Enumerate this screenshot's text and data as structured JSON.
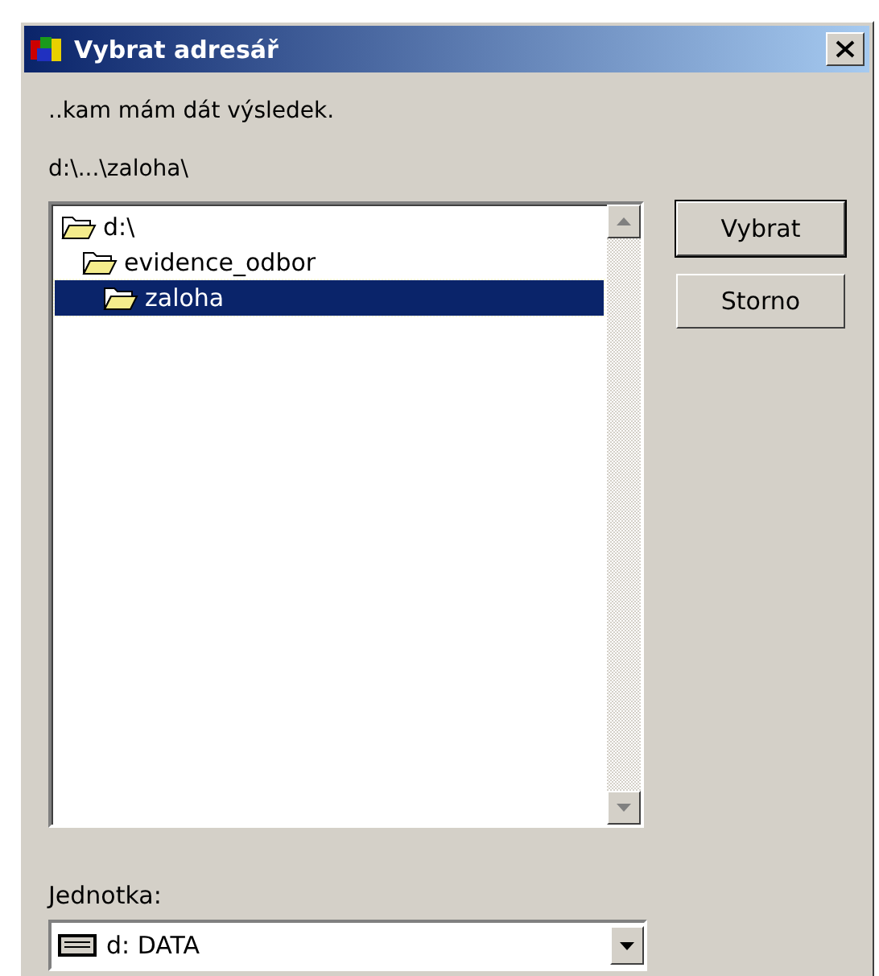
{
  "window": {
    "title": "Vybrat adresář"
  },
  "prompt": "..kam mám dát výsledek.",
  "current_path": "d:\\...\\zaloha\\",
  "folder_tree": [
    {
      "label": "d:\\",
      "selected": false,
      "children": [
        {
          "label": "evidence_odbor",
          "selected": false,
          "children": [
            {
              "label": "zaloha",
              "selected": true
            }
          ]
        }
      ]
    }
  ],
  "buttons": [
    {
      "label": "Vybrat",
      "default": true
    },
    {
      "label": "Storno",
      "default": false
    }
  ],
  "drive": {
    "label": "Jednotka:",
    "value": "d: DATA"
  }
}
